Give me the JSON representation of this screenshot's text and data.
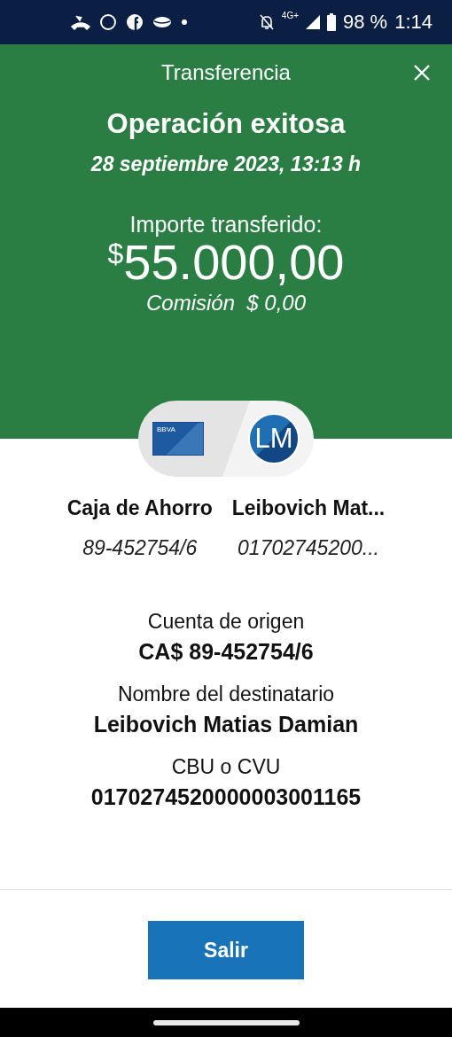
{
  "status_bar": {
    "network": "4G+",
    "battery": "98 %",
    "time": "1:14"
  },
  "header": {
    "title": "Transferencia",
    "status": "Operación exitosa",
    "date": "28 septiembre 2023, 13:13 h",
    "amount_label": "Importe transferido:",
    "currency": "$",
    "amount": "55.000,00",
    "commission": "Comisión  $ 0,00"
  },
  "parties": {
    "card_logo": "BBVA",
    "avatar_initials": "LM",
    "origin": {
      "name": "Caja de Ahorro",
      "number": "89-452754/6"
    },
    "destination": {
      "name": "Leibovich Mat...",
      "number": "01702745200..."
    }
  },
  "details": [
    {
      "label": "Cuenta de origen",
      "value": "CA$ 89-452754/6"
    },
    {
      "label": "Nombre del destinatario",
      "value": "Leibovich Matias Damian"
    },
    {
      "label": "CBU o CVU",
      "value": "0170274520000003001165"
    }
  ],
  "exit_button": "Salir"
}
